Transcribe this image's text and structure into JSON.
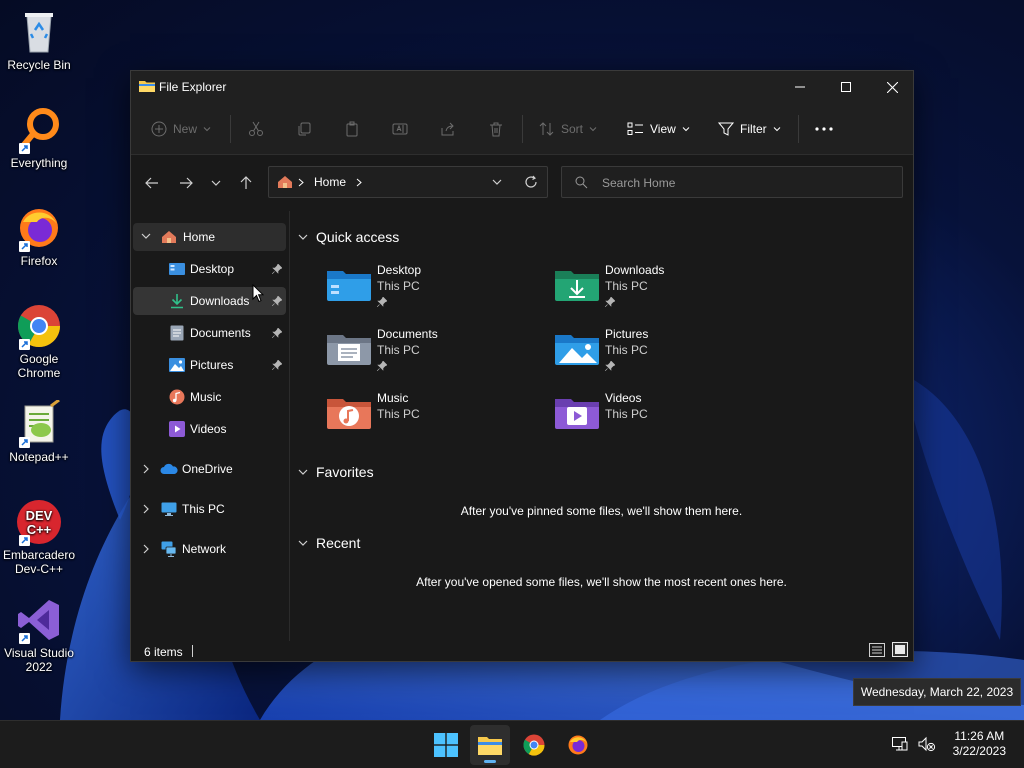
{
  "desktop": {
    "icons": [
      {
        "name": "recycle-bin",
        "label": "Recycle Bin"
      },
      {
        "name": "everything",
        "label": "Everything"
      },
      {
        "name": "firefox",
        "label": "Firefox"
      },
      {
        "name": "google-chrome",
        "label": "Google Chrome"
      },
      {
        "name": "notepad-plus-plus",
        "label": "Notepad++"
      },
      {
        "name": "embarcadero-dev-cpp",
        "label": "Embarcadero Dev-C++"
      },
      {
        "name": "visual-studio-2022",
        "label": "Visual Studio 2022"
      }
    ]
  },
  "window": {
    "title": "File Explorer",
    "toolbar": {
      "new_label": "New",
      "sort_label": "Sort",
      "view_label": "View",
      "filter_label": "Filter"
    },
    "address": {
      "location": "Home"
    },
    "search": {
      "placeholder": "Search Home"
    },
    "sidebar": {
      "home": "Home",
      "pinned": [
        {
          "label": "Desktop",
          "icon": "desktop-icon",
          "pinned": true
        },
        {
          "label": "Downloads",
          "icon": "downloads-icon",
          "pinned": true
        },
        {
          "label": "Documents",
          "icon": "documents-icon",
          "pinned": true
        },
        {
          "label": "Pictures",
          "icon": "pictures-icon",
          "pinned": true
        },
        {
          "label": "Music",
          "icon": "music-icon",
          "pinned": false
        },
        {
          "label": "Videos",
          "icon": "videos-icon",
          "pinned": false
        }
      ],
      "roots": [
        {
          "label": "OneDrive",
          "icon": "cloud-icon"
        },
        {
          "label": "This PC",
          "icon": "monitor-icon"
        },
        {
          "label": "Network",
          "icon": "network-icon"
        }
      ]
    },
    "content": {
      "quick_access": {
        "title": "Quick access",
        "items": [
          {
            "name": "Desktop",
            "location": "This PC",
            "pinned": true,
            "color": "#2f9ee8"
          },
          {
            "name": "Downloads",
            "location": "This PC",
            "pinned": true,
            "color": "#23a574"
          },
          {
            "name": "Documents",
            "location": "This PC",
            "pinned": true,
            "color": "#8d98a8"
          },
          {
            "name": "Pictures",
            "location": "This PC",
            "pinned": true,
            "color": "#2f9ee8"
          },
          {
            "name": "Music",
            "location": "This PC",
            "pinned": false,
            "color": "#e8775a"
          },
          {
            "name": "Videos",
            "location": "This PC",
            "pinned": false,
            "color": "#8d5ad6"
          }
        ]
      },
      "favorites": {
        "title": "Favorites",
        "empty": "After you've pinned some files, we'll show them here."
      },
      "recent": {
        "title": "Recent",
        "empty": "After you've opened some files, we'll show the most recent ones here."
      }
    },
    "status": {
      "item_count": "6 items"
    }
  },
  "tooltip": {
    "text": "Wednesday, March 22, 2023"
  },
  "taskbar": {
    "apps": [
      "start",
      "file-explorer",
      "google-chrome",
      "firefox"
    ],
    "clock": {
      "time": "11:26 AM",
      "date": "3/22/2023"
    }
  },
  "colors": {
    "accent": "#5fb2f2",
    "window_bg": "#191919",
    "taskbar_bg": "#1c1c1c"
  }
}
